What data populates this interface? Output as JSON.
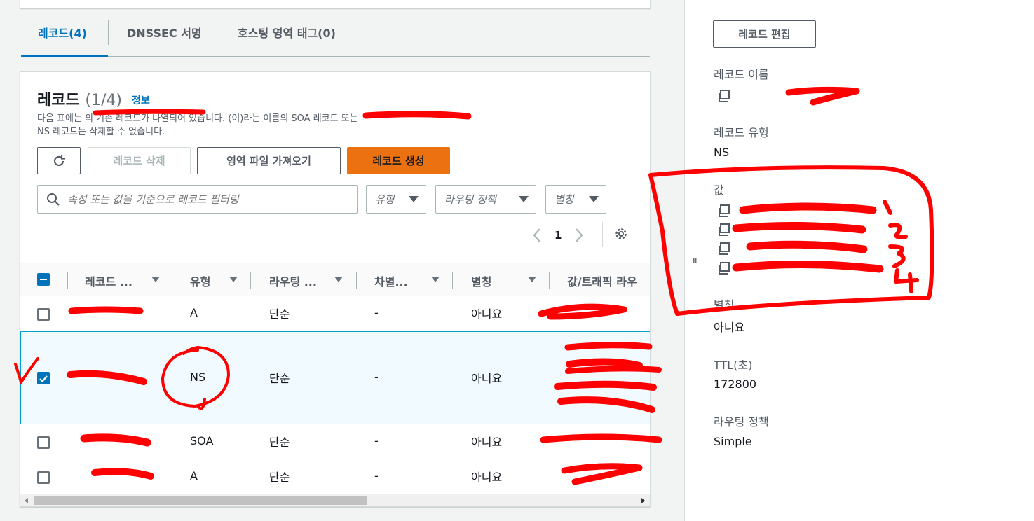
{
  "tabs": [
    {
      "label": "레코드(4)"
    },
    {
      "label": "DNSSEC 서명"
    },
    {
      "label": "호스팅 영역 태그(0)"
    }
  ],
  "records_card": {
    "title": "레코드",
    "count": "(1/4)",
    "info_link": "정보",
    "description_line1": "다음 표에는 의 기존 레코드가 나열되어 있습니다. (이)라는 이름의 SOA 레코드 또는",
    "description_line2": "NS 레코드는 삭제할 수 없습니다.",
    "buttons": {
      "delete": "레코드 삭제",
      "import": "영역 파일 가져오기",
      "create": "레코드 생성"
    },
    "search_placeholder": "속성 또는 값을 기준으로 레코드 필터링",
    "filters": {
      "type": "유형",
      "routing": "라우팅 정책",
      "alias": "별칭"
    },
    "pagination": {
      "current_page": "1"
    }
  },
  "table": {
    "columns": [
      "레코드 ...",
      "유형",
      "라우팅 ...",
      "차별...",
      "별칭",
      "값/트래픽 라우"
    ],
    "rows": [
      {
        "type": "A",
        "routing": "단순",
        "diff": "-",
        "alias": "아니요",
        "selected": false
      },
      {
        "type": "NS",
        "routing": "단순",
        "diff": "-",
        "alias": "아니요",
        "selected": true
      },
      {
        "type": "SOA",
        "routing": "단순",
        "diff": "-",
        "alias": "아니요",
        "selected": false
      },
      {
        "type": "A",
        "routing": "단순",
        "diff": "-",
        "alias": "아니요",
        "selected": false
      }
    ]
  },
  "details": {
    "edit_button": "레코드 편집",
    "record_name_label": "레코드 이름",
    "record_type_label": "레코드 유형",
    "record_type_value": "NS",
    "value_label": "값",
    "alias_label": "별칭",
    "alias_value": "아니요",
    "ttl_label": "TTL(초)",
    "ttl_value": "172800",
    "routing_label": "라우팅 정책",
    "routing_value": "Simple"
  },
  "annotation_color": "#ff0000",
  "colors": {
    "accent": "#0073bb",
    "primary_button": "#ec7211"
  }
}
